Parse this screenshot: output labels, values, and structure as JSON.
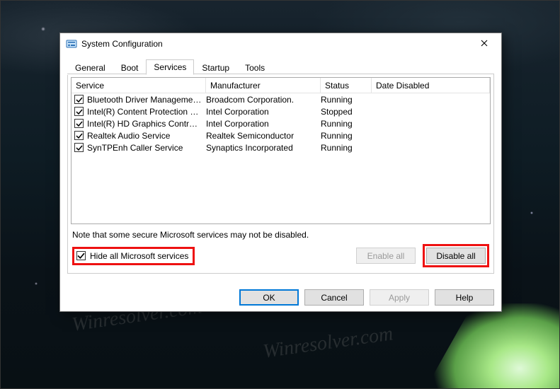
{
  "watermark_text": "Winresolver.com",
  "dialog": {
    "title": "System Configuration",
    "tabs": [
      "General",
      "Boot",
      "Services",
      "Startup",
      "Tools"
    ],
    "active_tab_index": 2,
    "services": {
      "columns": [
        "Service",
        "Manufacturer",
        "Status",
        "Date Disabled"
      ],
      "rows": [
        {
          "checked": true,
          "service": "Bluetooth Driver Management S...",
          "manufacturer": "Broadcom Corporation.",
          "status": "Running",
          "date_disabled": ""
        },
        {
          "checked": true,
          "service": "Intel(R) Content Protection HEC...",
          "manufacturer": "Intel Corporation",
          "status": "Stopped",
          "date_disabled": ""
        },
        {
          "checked": true,
          "service": "Intel(R) HD Graphics Control Pa...",
          "manufacturer": "Intel Corporation",
          "status": "Running",
          "date_disabled": ""
        },
        {
          "checked": true,
          "service": "Realtek Audio Service",
          "manufacturer": "Realtek Semiconductor",
          "status": "Running",
          "date_disabled": ""
        },
        {
          "checked": true,
          "service": "SynTPEnh Caller Service",
          "manufacturer": "Synaptics Incorporated",
          "status": "Running",
          "date_disabled": ""
        }
      ],
      "note": "Note that some secure Microsoft services may not be disabled.",
      "hide_ms": {
        "checked": true,
        "label": "Hide all Microsoft services"
      },
      "enable_all": "Enable all",
      "disable_all": "Disable all"
    },
    "buttons": {
      "ok": "OK",
      "cancel": "Cancel",
      "apply": "Apply",
      "help": "Help"
    }
  }
}
